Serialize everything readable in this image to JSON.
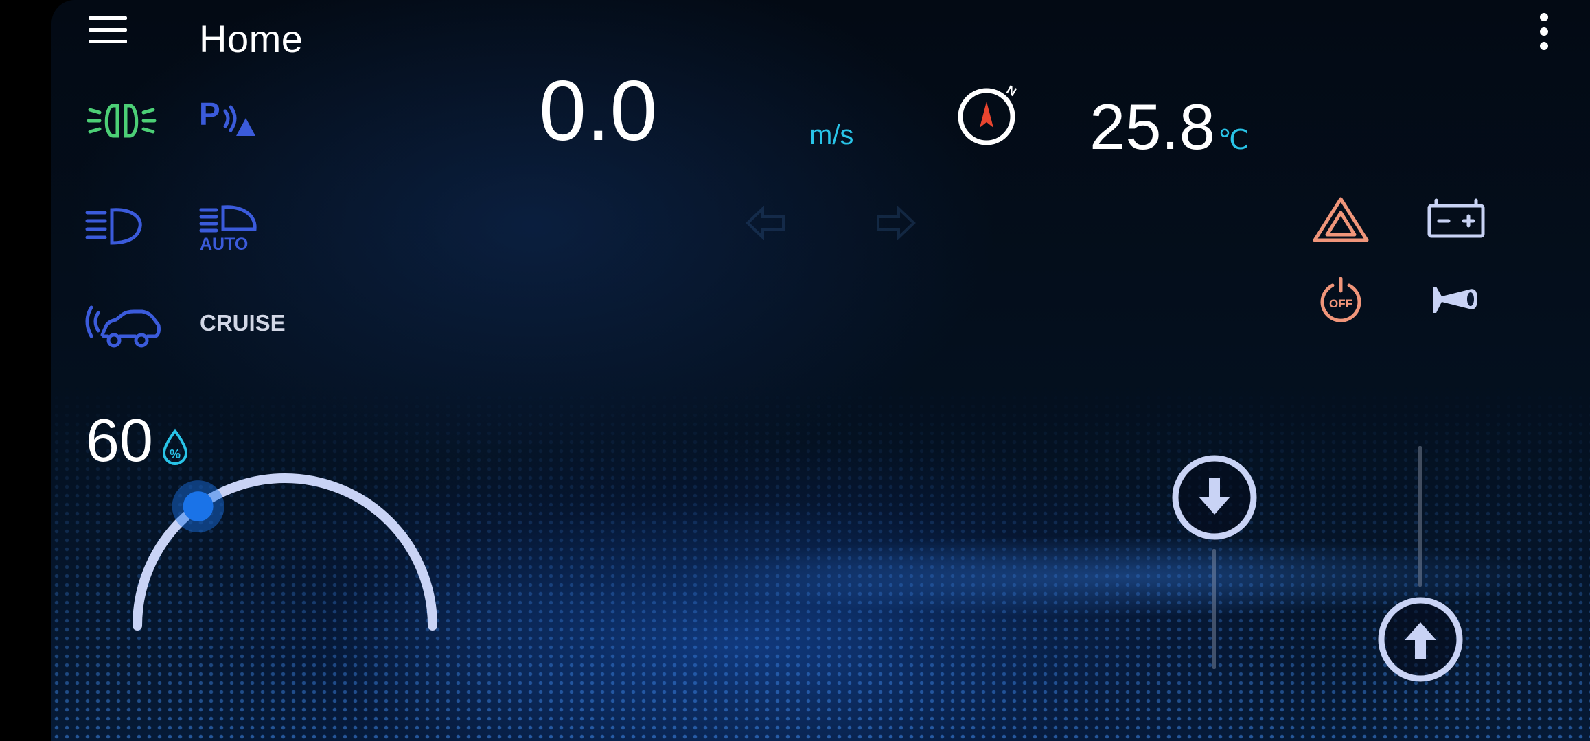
{
  "header": {
    "title": "Home",
    "menu_icon": "menu-icon",
    "more_icon": "more-vert-icon"
  },
  "speed": {
    "value": "0.0",
    "unit": "m/s"
  },
  "compass": {
    "icon": "compass-icon",
    "north_label": "N"
  },
  "temperature": {
    "value": "25.8",
    "unit": "℃"
  },
  "indicators": {
    "fog_lights": "fog-light-icon",
    "parking_sensor": "parking-sensor-icon",
    "parking_label": "P",
    "low_beam": "low-beam-icon",
    "auto_headlight": "auto-headlight-icon",
    "auto_label": "AUTO",
    "adaptive_cruise": "adaptive-cruise-icon",
    "cruise_label": "CRUISE",
    "hazard": "hazard-icon",
    "battery": "battery-icon",
    "power_off": "power-off-icon",
    "power_off_label": "OFF",
    "horn": "horn-icon"
  },
  "humidity": {
    "value": "60",
    "icon": "humidity-drop-icon",
    "percent_glyph": "%",
    "slider_level": 0.3
  },
  "controls": {
    "down_button": "arrow-down-icon",
    "up_button": "arrow-up-icon"
  },
  "colors": {
    "accent_blue": "#3b5bdb",
    "fog_green": "#4ccf76",
    "cyan": "#29c4e8",
    "warning_orange": "#f0957a",
    "knob_blue": "#1a73e8",
    "ring_light": "#c9d3f5"
  }
}
